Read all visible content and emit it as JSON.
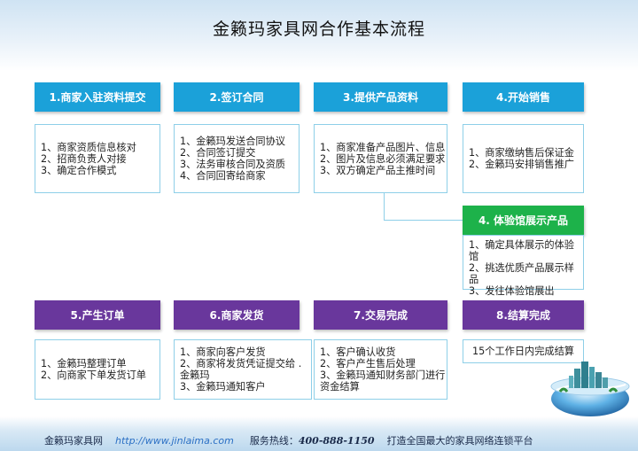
{
  "title": "金籁玛家具网合作基本流程",
  "steps": {
    "s1": {
      "label": "1.商家入驻资料提交",
      "items": [
        "1、商家资质信息核对",
        "2、招商负责人对接",
        "3、确定合作模式"
      ]
    },
    "s2": {
      "label": "2.签订合同",
      "items": [
        "1、金籁玛发送合同协议",
        "2、合同签订提交",
        "3、法务审核合同及资质",
        "4、合同回寄给商家"
      ]
    },
    "s3": {
      "label": "3.提供产品资料",
      "items": [
        "1、商家准备产品图片、信息",
        "2、图片及信息必须满足要求",
        "3、双方确定产品主推时间"
      ]
    },
    "s4": {
      "label": "4.开始销售",
      "items": [
        "1、商家缴纳售后保证金",
        "2、金籁玛安排销售推广"
      ]
    },
    "s4b": {
      "label": "4. 体验馆展示产品",
      "items": [
        "1、确定具体展示的体验馆",
        "2、挑选优质产品展示样品",
        "3、发往体验馆展出"
      ]
    },
    "s5": {
      "label": "5.产生订单",
      "items": [
        "1、金籁玛整理订单",
        "2、向商家下单发货订单"
      ]
    },
    "s6": {
      "label": "6.商家发货",
      "items": [
        "1、商家向客户发货",
        "2、商家将发货凭证提交给 .",
        "金籁玛",
        "3、金籁玛通知客户"
      ]
    },
    "s7": {
      "label": "7.交易完成",
      "items": [
        "1、客户确认收货",
        "2、客户产生售后处理",
        "3、金籁玛通知财务部门进行",
        "资金结算"
      ]
    },
    "s8": {
      "label": "8.结算完成",
      "items": [
        "15个工作日内完成结算"
      ]
    }
  },
  "footer": {
    "brand": "金籁玛家具网",
    "url": "http://www.jinlaima.com",
    "hotline_label": "服务热线：",
    "hotline": "400-888-1150",
    "slogan": "打造全国最大的家具网络连锁平台"
  },
  "colors": {
    "blue": "#1ba1d9",
    "green": "#1db24a",
    "purple": "#69379c",
    "border": "#8ecfe8"
  }
}
